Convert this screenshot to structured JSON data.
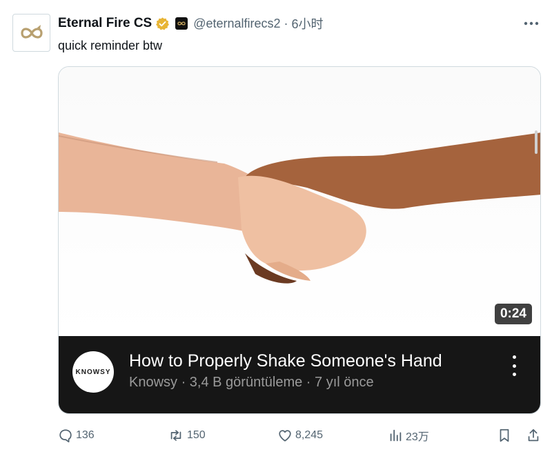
{
  "author": {
    "display_name": "Eternal Fire CS",
    "handle": "@eternalfirecs2",
    "separator": "·",
    "time": "6小时",
    "verified_color": "#E8B536"
  },
  "tweet": {
    "text": "quick reminder btw"
  },
  "media": {
    "duration": "0:24",
    "channel_logo_text": "KNOWSY",
    "video_title": "How to Properly Shake Someone's Hand",
    "video_meta": "Knowsy · 3,4 B görüntüleme · 7 yıl önce",
    "bar_color": "#161616"
  },
  "actions": {
    "replies": "136",
    "reposts": "150",
    "likes": "8,245",
    "views": "23万",
    "icon_names": [
      "reply-icon",
      "repost-icon",
      "like-icon",
      "views-icon",
      "bookmark-icon",
      "share-icon"
    ]
  }
}
